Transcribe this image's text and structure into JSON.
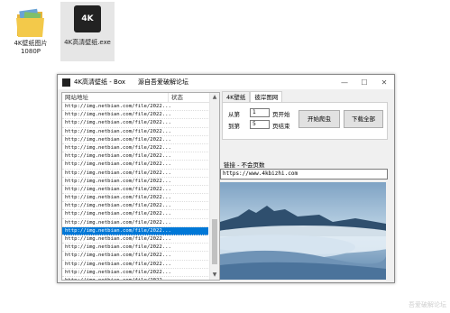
{
  "desktop": {
    "icons": [
      {
        "label_line1": "4K壁纸图片",
        "label_line2": "1080P"
      },
      {
        "label_line1": "4K高清壁纸.exe",
        "label_line2": ""
      }
    ],
    "exe_badge": "4K"
  },
  "window": {
    "title": "4K高清壁纸 - Box",
    "subtitle": "源自吾爱破解论坛",
    "controls": {
      "minimize": "—",
      "maximize": "☐",
      "close": "✕"
    }
  },
  "list": {
    "col_url": "网站地址",
    "col_status": "状态",
    "rows": [
      "http://img.netbian.com/file/2022...",
      "http://img.netbian.com/file/2022...",
      "http://img.netbian.com/file/2022...",
      "http://img.netbian.com/file/2022...",
      "http://img.netbian.com/file/2022...",
      "http://img.netbian.com/file/2022...",
      "http://img.netbian.com/file/2022...",
      "http://img.netbian.com/file/2022...",
      "http://img.netbian.com/file/2022...",
      "http://img.netbian.com/file/2022...",
      "http://img.netbian.com/file/2022...",
      "http://img.netbian.com/file/2022...",
      "http://img.netbian.com/file/2022...",
      "http://img.netbian.com/file/2022...",
      "http://img.netbian.com/file/2022...",
      "http://img.netbian.com/file/2022...",
      "http://img.netbian.com/file/2022...",
      "http://img.netbian.com/file/2022...",
      "http://img.netbian.com/file/2022...",
      "http://img.netbian.com/file/2022...",
      "http://img.netbian.com/file/2022...",
      "http://img.netbian.com/file/2022...",
      "http://img.netbian.com/file/2022...",
      "http://img.netbian.com/file/2022..."
    ],
    "selected_index": 15,
    "selection_color": "#0078d7"
  },
  "tabs": [
    {
      "label": "4K壁纸",
      "active": false
    },
    {
      "label": "彼岸图网",
      "active": true
    }
  ],
  "range": {
    "from_label": "从第",
    "from_value": "1",
    "from_suffix": "页开始",
    "to_label": "到第",
    "to_value": "5",
    "to_suffix": "页结束"
  },
  "buttons": {
    "start": "开始爬虫",
    "download_all": "下载全部"
  },
  "link": {
    "label": "链接 - 不会页数",
    "url": "https://www.4kbizhi.com"
  },
  "watermark": "吾爱破解论坛"
}
